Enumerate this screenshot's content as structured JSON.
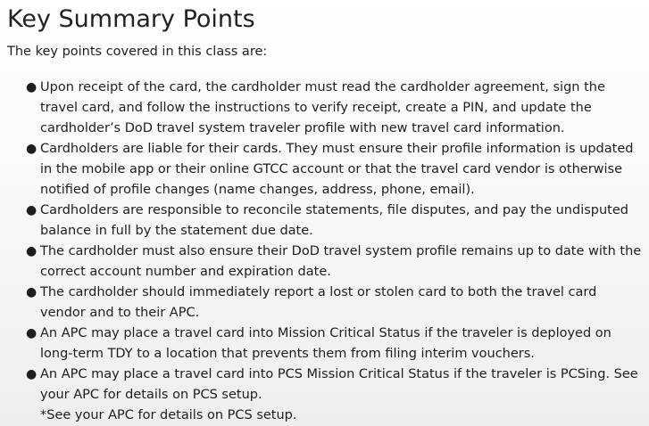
{
  "page": {
    "title": "Key Summary Points",
    "intro": "The key points covered in this class are:"
  },
  "points": [
    "Upon receipt of the card, the cardholder must read the cardholder agreement, sign the travel card, and follow the instructions to verify receipt, create a PIN, and update the cardholder’s DoD travel system traveler profile with new travel card information.",
    "Cardholders are liable for their cards. They must ensure their profile information is updated in the mobile app or their online GTCC account or that the travel card vendor is otherwise notified of profile changes (name changes, address, phone, email).",
    "Cardholders are responsible to reconcile statements, file disputes, and pay the undisputed balance in full by the statement due date.",
    "The cardholder must also ensure their DoD travel system profile remains up to date with the correct account number and expiration date.",
    "The cardholder should immediately report a lost or stolen card to both the travel card vendor and to their APC.",
    "An APC may place a travel card into Mission Critical Status if the traveler is deployed on long-term TDY to a location that prevents them from filing interim vouchers.",
    "An APC may place a travel card into PCS Mission Critical Status if the traveler is PCSing. See your APC for details on PCS setup."
  ],
  "last_point_note": "*See your APC for details on PCS setup."
}
